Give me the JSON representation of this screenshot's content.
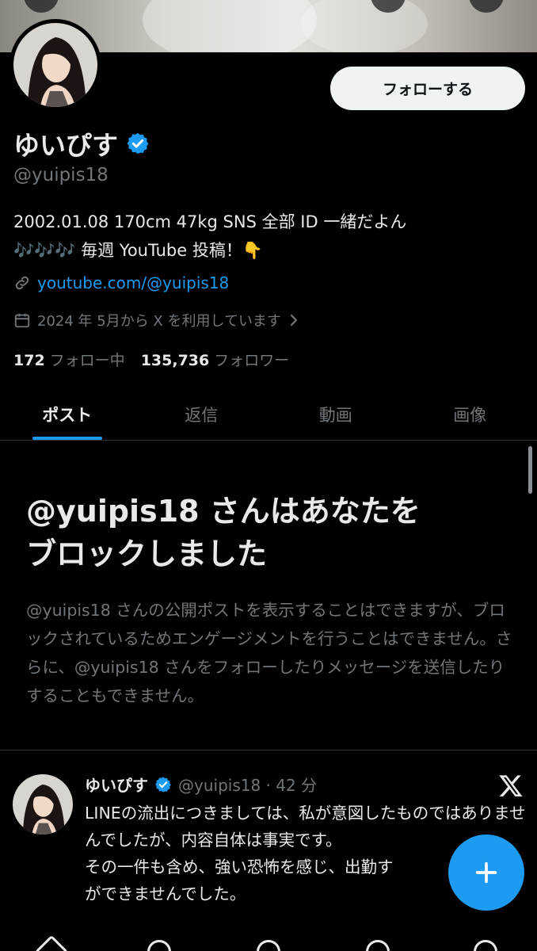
{
  "profile": {
    "follow_label": "フォローする",
    "display_name": "ゆいぴす",
    "handle": "@yuipis18",
    "bio_line1": "2002.01.08 170cm 47kg SNS 全部 ID 一緒だよん",
    "bio_line2": "🎶🎶🎶 毎週 YouTube 投稿！👇",
    "link": "youtube.com/@yuipis18",
    "joined": "2024 年 5月から X を利用しています",
    "following_count": "172",
    "following_label": "フォロー中",
    "followers_count": "135,736",
    "followers_label": "フォロワー"
  },
  "tabs": [
    {
      "label": "ポスト"
    },
    {
      "label": "返信"
    },
    {
      "label": "動画"
    },
    {
      "label": "画像"
    }
  ],
  "blocked": {
    "title_line1": "@yuipis18 さんはあなたを",
    "title_line2": "ブロックしました",
    "desc": "@yuipis18 さんの公開ポストを表示することはできますが、ブロックされているためエンゲージメントを行うことはできません。さらに、@yuipis18 さんをフォローしたりメッセージを送信したりすることもできません。"
  },
  "tweet": {
    "name": "ゆいぴす",
    "handle_time": "@yuipis18 · 42 分",
    "text": "LINEの流出につきましては、私が意図したものではありませんでしたが、内容自体は事実です。\nその一件も含め、強い恐怖を感じ、出勤す\nができませんでした。"
  },
  "colors": {
    "accent": "#1d9bf0",
    "background": "#000000",
    "text": "#e7e9ea",
    "muted": "#71767b"
  },
  "icons": [
    "verified-badge-icon",
    "link-icon",
    "calendar-icon",
    "chevron-right-icon",
    "x-logo-icon",
    "plus-icon"
  ]
}
